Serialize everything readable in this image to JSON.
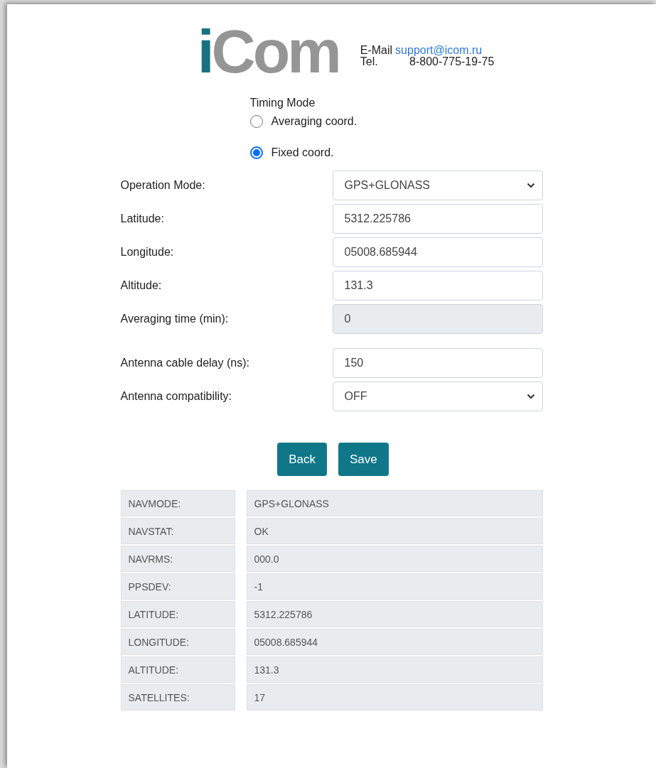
{
  "header": {
    "logo": "iCom",
    "contacts": [
      {
        "label": "E-Mail",
        "value": "support@icom.ru",
        "kind": "link"
      },
      {
        "label": "Tel.",
        "value": "8-800-775-19-75",
        "kind": "text"
      }
    ]
  },
  "timing_mode": {
    "title": "Timing Mode",
    "options": [
      {
        "label": "Averaging coord.",
        "selected": false
      },
      {
        "label": "Fixed coord.",
        "selected": true
      }
    ]
  },
  "form": [
    {
      "fields": [
        {
          "label": "Operation Mode:",
          "kind": "select",
          "value": "GPS+GLONASS",
          "disabled": false
        },
        {
          "label": "Latitude:",
          "kind": "text",
          "value": "5312.225786",
          "disabled": false
        },
        {
          "label": "Longitude:",
          "kind": "text",
          "value": "05008.685944",
          "disabled": false
        },
        {
          "label": "Altitude:",
          "kind": "text",
          "value": "131.3",
          "disabled": false
        },
        {
          "label": "Averaging time (min):",
          "kind": "text",
          "value": "0",
          "disabled": true
        }
      ]
    },
    {
      "fields": [
        {
          "label": "Antenna cable delay (ns):",
          "kind": "text",
          "value": "150",
          "disabled": false
        },
        {
          "label": "Antenna compatibility:",
          "kind": "select",
          "value": "OFF",
          "disabled": false
        }
      ]
    }
  ],
  "buttons": [
    "Back",
    "Save"
  ],
  "status": [
    {
      "name": "NAVMODE:",
      "value": "GPS+GLONASS"
    },
    {
      "name": "NAVSTAT:",
      "value": "OK"
    },
    {
      "name": "NAVRMS:",
      "value": "000.0"
    },
    {
      "name": "PPSDEV:",
      "value": "-1"
    },
    {
      "name": "LATITUDE:",
      "value": "5312.225786"
    },
    {
      "name": "LONGITUDE:",
      "value": "05008.685944"
    },
    {
      "name": "ALTITUDE:",
      "value": "131.3"
    },
    {
      "name": "SATELLITES:",
      "value": "17"
    }
  ]
}
